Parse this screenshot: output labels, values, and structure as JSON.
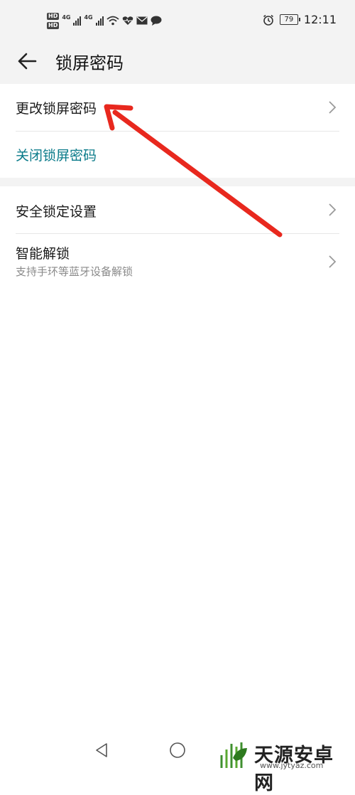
{
  "status_bar": {
    "hd_1": "HD",
    "hd_2": "HD",
    "network_1": "4G",
    "network_2": "4G",
    "battery": "79",
    "time": "12:11",
    "icons": [
      "signal-icon",
      "wifi-icon",
      "health-icon",
      "mail-icon",
      "chat-icon",
      "alarm-icon",
      "battery-icon"
    ]
  },
  "app_bar": {
    "back_icon": "arrow-left-icon",
    "title": "锁屏密码"
  },
  "sections": [
    {
      "items": [
        {
          "label": "更改锁屏密码"
        },
        {
          "label": "关闭锁屏密码",
          "color": "#0a7b8a"
        }
      ]
    },
    {
      "items": [
        {
          "label": "安全锁定设置"
        },
        {
          "label": "智能解锁",
          "subtitle": "支持手环等蓝牙设备解锁"
        }
      ]
    }
  ],
  "annotation": {
    "type": "arrow",
    "color": "#e8281e"
  },
  "nav_bar": {
    "icons": [
      "back-triangle-icon",
      "home-circle-icon"
    ]
  },
  "watermark": {
    "title": "天源安卓网",
    "url": "www.jytyaz.com"
  }
}
